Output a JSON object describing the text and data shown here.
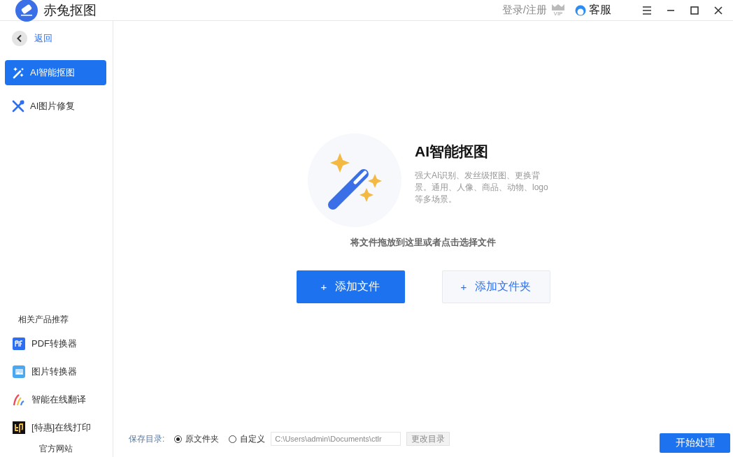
{
  "app": {
    "title": "赤兔抠图"
  },
  "header": {
    "login": "登录/注册",
    "vip": "VIP",
    "service": "客服"
  },
  "sidebar": {
    "back": "返回",
    "items": [
      {
        "label": "AI智能抠图",
        "selected": true
      },
      {
        "label": "AI图片修复",
        "selected": false
      }
    ],
    "related_title": "相关产品推荐",
    "products": [
      {
        "label": "PDF转换器"
      },
      {
        "label": "图片转换器"
      },
      {
        "label": "智能在线翻译"
      },
      {
        "label": "[特惠]在线打印"
      }
    ],
    "official_site": "官方网站"
  },
  "main": {
    "title": "AI智能抠图",
    "description": "强大AI识别、发丝级抠图、更换背景。通用、人像、商品、动物、logo等多场景。",
    "hint": "将文件拖放到这里或者点击选择文件",
    "buttons": [
      {
        "plus": "+",
        "label": "添加文件",
        "kind": "primary"
      },
      {
        "plus": "+",
        "label": "添加文件夹",
        "kind": "secondary"
      }
    ]
  },
  "footer": {
    "save_label": "保存目录:",
    "options": [
      {
        "label": "原文件夹",
        "selected": true
      },
      {
        "label": "自定义",
        "selected": false
      }
    ],
    "path": "C:\\Users\\admin\\Documents\\ctlr",
    "change_button": "更改目录",
    "start_button": "开始处理"
  }
}
